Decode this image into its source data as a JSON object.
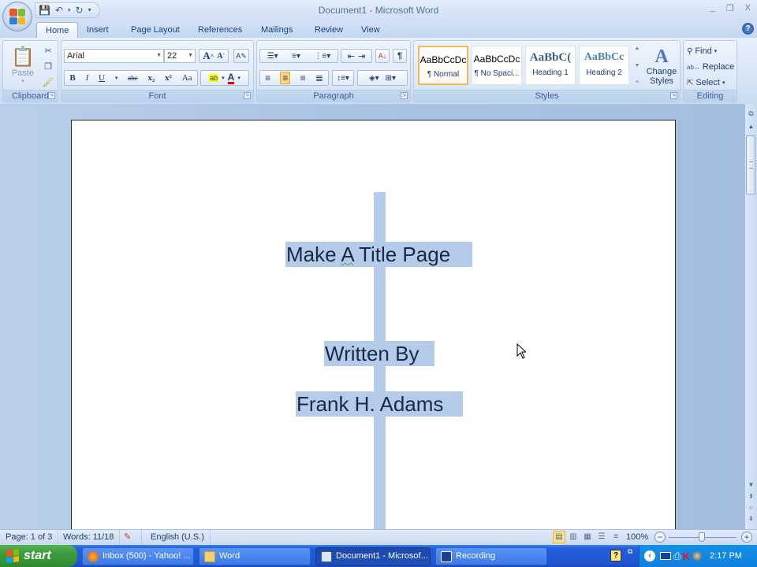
{
  "window": {
    "title": "Document1 - Microsoft Word",
    "controls": {
      "minimize": "_",
      "restore": "❐",
      "close": "X"
    }
  },
  "quick_access": {
    "save_icon": "save-icon",
    "undo_icon": "undo-icon",
    "redo_icon": "redo-icon",
    "customize": "▾"
  },
  "tabs": [
    {
      "label": "Home",
      "active": true
    },
    {
      "label": "Insert"
    },
    {
      "label": "Page Layout"
    },
    {
      "label": "References"
    },
    {
      "label": "Mailings"
    },
    {
      "label": "Review"
    },
    {
      "label": "View"
    }
  ],
  "ribbon": {
    "clipboard": {
      "label": "Clipboard",
      "paste": "Paste"
    },
    "font": {
      "label": "Font",
      "font_name": "Arial",
      "font_size": "22",
      "buttons": [
        "B",
        "I",
        "U",
        "abc",
        "x₂",
        "x²",
        "Aa"
      ]
    },
    "paragraph": {
      "label": "Paragraph",
      "active_alignment": "center"
    },
    "styles": {
      "label": "Styles",
      "items": [
        {
          "sample": "AaBbCcDc",
          "name": "¶ Normal",
          "selected": true
        },
        {
          "sample": "AaBbCcDc",
          "name": "¶ No Spaci..."
        },
        {
          "sample": "AaBbC(",
          "name": "Heading 1"
        },
        {
          "sample": "AaBbCc",
          "name": "Heading 2"
        }
      ],
      "change_styles": "Change Styles"
    },
    "editing": {
      "label": "Editing",
      "find": "Find",
      "replace": "Replace",
      "select": "Select"
    }
  },
  "document": {
    "lines": [
      "Make A Title Page",
      "Written By",
      "Frank H. Adams"
    ],
    "highlight_color": "#b4ccea"
  },
  "status": {
    "page": "Page: 1 of 3",
    "words": "Words: 11/18",
    "language": "English (U.S.)",
    "zoom": "100%",
    "zoom_level_percent": 100,
    "active_view": "print-layout"
  },
  "taskbar": {
    "start": "start",
    "tasks": [
      {
        "label": "Inbox (500) - Yahoo! ...",
        "icon": "firefox-icon"
      },
      {
        "label": "Word",
        "icon": "folder-icon"
      },
      {
        "label": "Document1 - Microsof...",
        "icon": "word-doc-icon",
        "active": true
      },
      {
        "label": "Recording",
        "icon": "recorder-icon"
      }
    ],
    "clock": "2:17 PM"
  }
}
